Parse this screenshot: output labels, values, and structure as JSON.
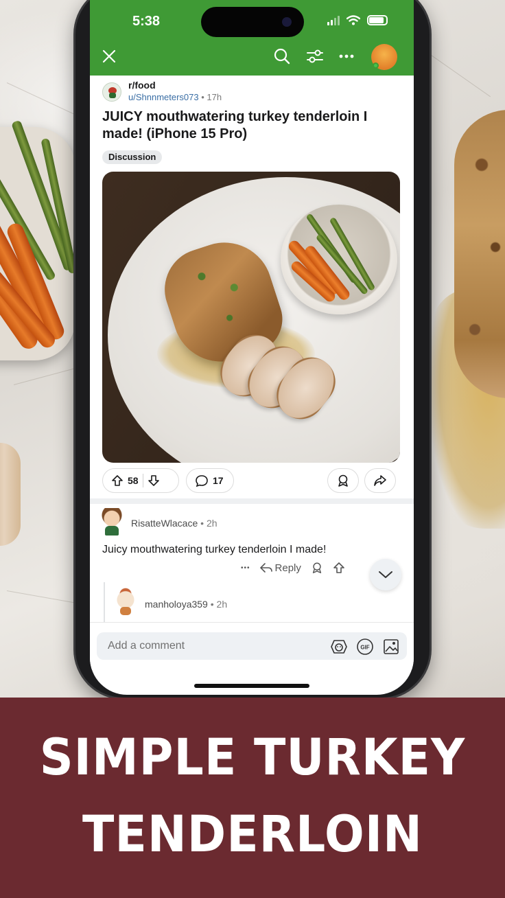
{
  "status_bar": {
    "time": "5:38"
  },
  "header": {
    "close_icon": "close-icon",
    "search_icon": "search-icon",
    "filter_icon": "sliders-icon",
    "more_icon": "more-horizontal-icon",
    "avatar": "user-avatar"
  },
  "post": {
    "subreddit": "r/food",
    "author": "u/Shnnmeters073",
    "age": "• 17h",
    "title": "JUICY mouthwatering turkey tenderloin I made! (iPhone 15 Pro)",
    "flair": "Discussion",
    "upvotes": "58",
    "comments": "17"
  },
  "comments": [
    {
      "author": "RisatteWlacace",
      "age": "• 2h",
      "text": "Juicy mouthwatering turkey tenderloin I made!",
      "reply_label": "Reply",
      "more_label": "•••"
    },
    {
      "author": "manholoya359",
      "age": "• 2h"
    }
  ],
  "comment_box": {
    "placeholder": "Add a comment",
    "gif_label": "GIF"
  },
  "banner": {
    "line1": "SIMPLE TURKEY",
    "line2": "TENDERLOIN"
  },
  "colors": {
    "header_green": "#3f9a35",
    "banner_maroon": "#6b2a30"
  }
}
